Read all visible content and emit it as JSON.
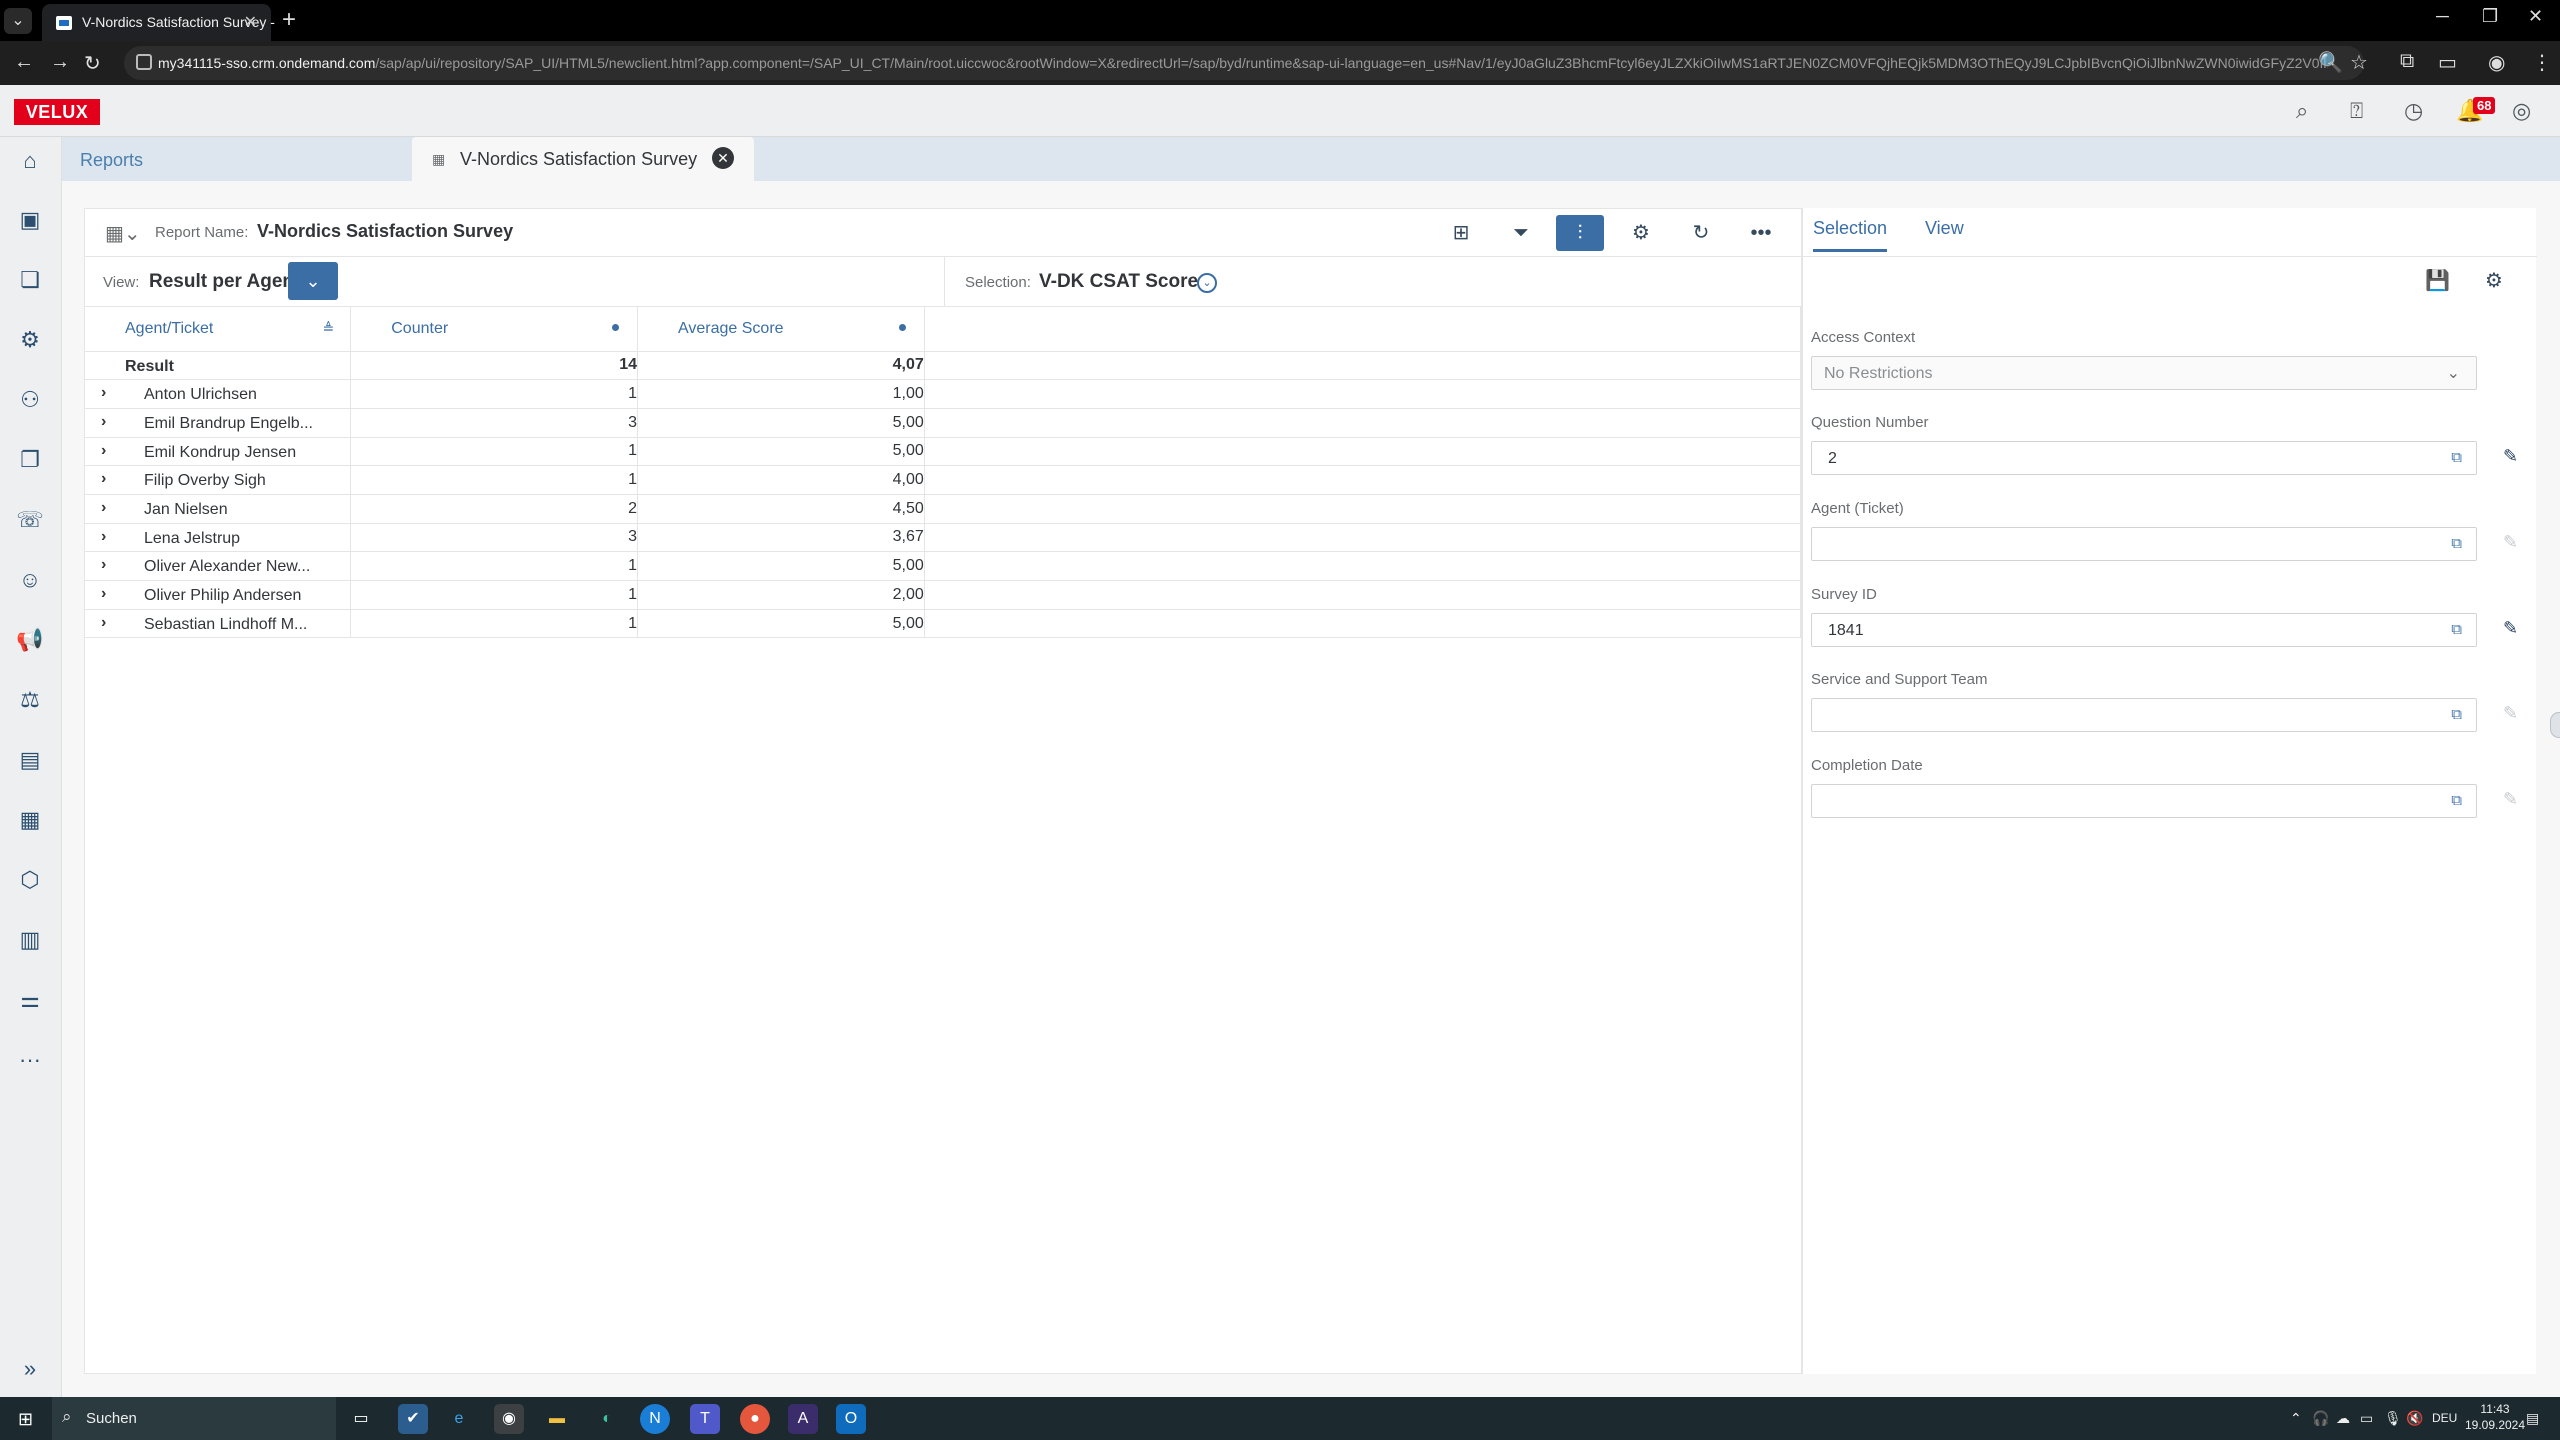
{
  "browser": {
    "tab_title": "V-Nordics Satisfaction Survey -",
    "url_host": "my341115-sso.crm.ondemand.com",
    "url_path": "/sap/ap/ui/repository/SAP_UI/HTML5/newclient.html?app.component=/SAP_UI_CT/Main/root.uiccwoc&rootWindow=X&redirectUrl=/sap/byd/runtime&sap-ui-language=en_us#Nav/1/eyJ0aGluZ3BhcmFtcyl6eyJLZXkiOiIwMS1aRTJEN0ZCM0VFQjhEQjk5MDM3OThEQyJ9LCJpbIBvcnQiOiJlbnNwZWN0iwidGFyZ2V0Il..."
  },
  "shell": {
    "logo": "VELUX",
    "notification_count": "68"
  },
  "workspace_tabs": {
    "reports": "Reports",
    "active": "V-Nordics Satisfaction Survey"
  },
  "report": {
    "name_label": "Report Name:",
    "name": "V-Nordics Satisfaction Survey",
    "view_label": "View:",
    "view_value": "Result per Agent",
    "selection_label": "Selection:",
    "selection_value": "V-DK CSAT Score"
  },
  "table": {
    "headers": {
      "agent": "Agent/Ticket",
      "counter": "Counter",
      "avg": "Average Score"
    },
    "result": {
      "label": "Result",
      "counter": "14",
      "avg": "4,07"
    },
    "rows": [
      {
        "agent": "Anton Ulrichsen",
        "counter": "1",
        "avg": "1,00"
      },
      {
        "agent": "Emil Brandrup Engelb...",
        "counter": "3",
        "avg": "5,00"
      },
      {
        "agent": "Emil Kondrup Jensen",
        "counter": "1",
        "avg": "5,00"
      },
      {
        "agent": "Filip Overby Sigh",
        "counter": "1",
        "avg": "4,00"
      },
      {
        "agent": "Jan Nielsen",
        "counter": "2",
        "avg": "4,50"
      },
      {
        "agent": "Lena Jelstrup",
        "counter": "3",
        "avg": "3,67"
      },
      {
        "agent": "Oliver Alexander New...",
        "counter": "1",
        "avg": "5,00"
      },
      {
        "agent": "Oliver Philip Andersen",
        "counter": "1",
        "avg": "2,00"
      },
      {
        "agent": "Sebastian Lindhoff M...",
        "counter": "1",
        "avg": "5,00"
      }
    ]
  },
  "selection_panel": {
    "tabs": {
      "selection": "Selection",
      "view": "View"
    },
    "fields": {
      "access_context": {
        "label": "Access Context",
        "value": "No Restrictions"
      },
      "question_number": {
        "label": "Question Number",
        "value": "2"
      },
      "agent_ticket": {
        "label": "Agent (Ticket)",
        "value": ""
      },
      "survey_id": {
        "label": "Survey ID",
        "value": "1841"
      },
      "service_team": {
        "label": "Service and Support Team",
        "value": ""
      },
      "completion_date": {
        "label": "Completion Date",
        "value": ""
      }
    }
  },
  "taskbar": {
    "search": "Suchen",
    "lang": "DEU",
    "time": "11:43",
    "date": "19.09.2024"
  },
  "colors": {
    "accent": "#3a6ea5",
    "brand": "#e3001b"
  }
}
